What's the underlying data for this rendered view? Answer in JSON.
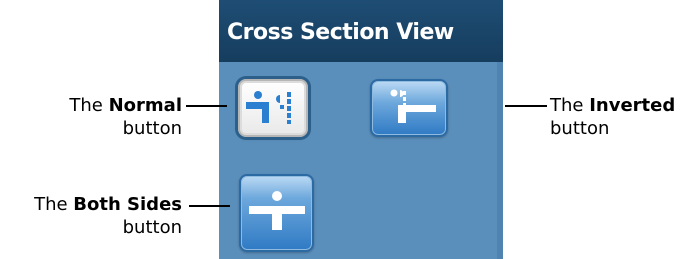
{
  "panel": {
    "title": "Cross Section View"
  },
  "buttons": {
    "normal": {
      "icon": "cross-section-normal-icon",
      "state": "selected"
    },
    "inverted": {
      "icon": "cross-section-inverted-icon",
      "state": "unselected"
    },
    "both_sides": {
      "icon": "cross-section-both-sides-icon",
      "state": "unselected"
    }
  },
  "callouts": {
    "normal": {
      "prefix": "The ",
      "bold": "Normal",
      "suffix": "button"
    },
    "inverted": {
      "prefix": "The ",
      "bold": "Inverted",
      "suffix": "button"
    },
    "both_sides": {
      "prefix": "The ",
      "bold": "Both Sides",
      "suffix": "button"
    }
  },
  "colors": {
    "panel_bg": "#5b8fbb",
    "header_bg": "#1e4d74",
    "button_blue": "#2f7ac4",
    "selected_icon": "#2a7fd0"
  }
}
